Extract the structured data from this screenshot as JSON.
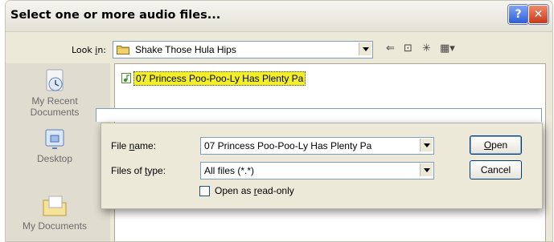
{
  "window": {
    "title": "Select one or more audio files...",
    "help_glyph": "?",
    "close_glyph": "✕"
  },
  "look_in": {
    "label_pre": "Look ",
    "label_key": "i",
    "label_post": "n:",
    "value": "Shake Those Hula Hips",
    "folder_icon": "folder-icon"
  },
  "toolbar": {
    "back_glyph": "⇐",
    "up_glyph": "⊡",
    "new_folder_glyph": "✳",
    "view_glyph": "▦▾"
  },
  "places": [
    {
      "name": "recent",
      "label_line1": "My Recent",
      "label_line2": "Documents",
      "icon": "recent-documents-icon"
    },
    {
      "name": "desktop",
      "label_line1": "Desktop",
      "label_line2": "",
      "icon": "desktop-icon"
    },
    {
      "name": "my-documents",
      "label_line1": "My Documents",
      "label_line2": "",
      "icon": "my-documents-icon"
    }
  ],
  "files": [
    {
      "name": "07 Princess Poo-Poo-Ly Has Plenty Pa",
      "selected": true,
      "icon": "audio-file-icon"
    }
  ],
  "form": {
    "file_name_pre": "File ",
    "file_name_key": "n",
    "file_name_post": "ame:",
    "file_name_value": "07 Princess Poo-Poo-Ly Has Plenty Pa",
    "files_of_type_pre": "Files of ",
    "files_of_type_key": "t",
    "files_of_type_post": "ype:",
    "files_of_type_value": "All files (*.*)",
    "read_only_pre": "Open as ",
    "read_only_key": "r",
    "read_only_post": "ead-only",
    "read_only_checked": false
  },
  "buttons": {
    "open_key": "O",
    "open_rest": "pen",
    "cancel": "Cancel"
  },
  "colors": {
    "selection_highlight": "#f2ef2a",
    "dialog_face": "#ece9d8",
    "title_close": "#c8391a",
    "title_help": "#2f5fd8"
  }
}
